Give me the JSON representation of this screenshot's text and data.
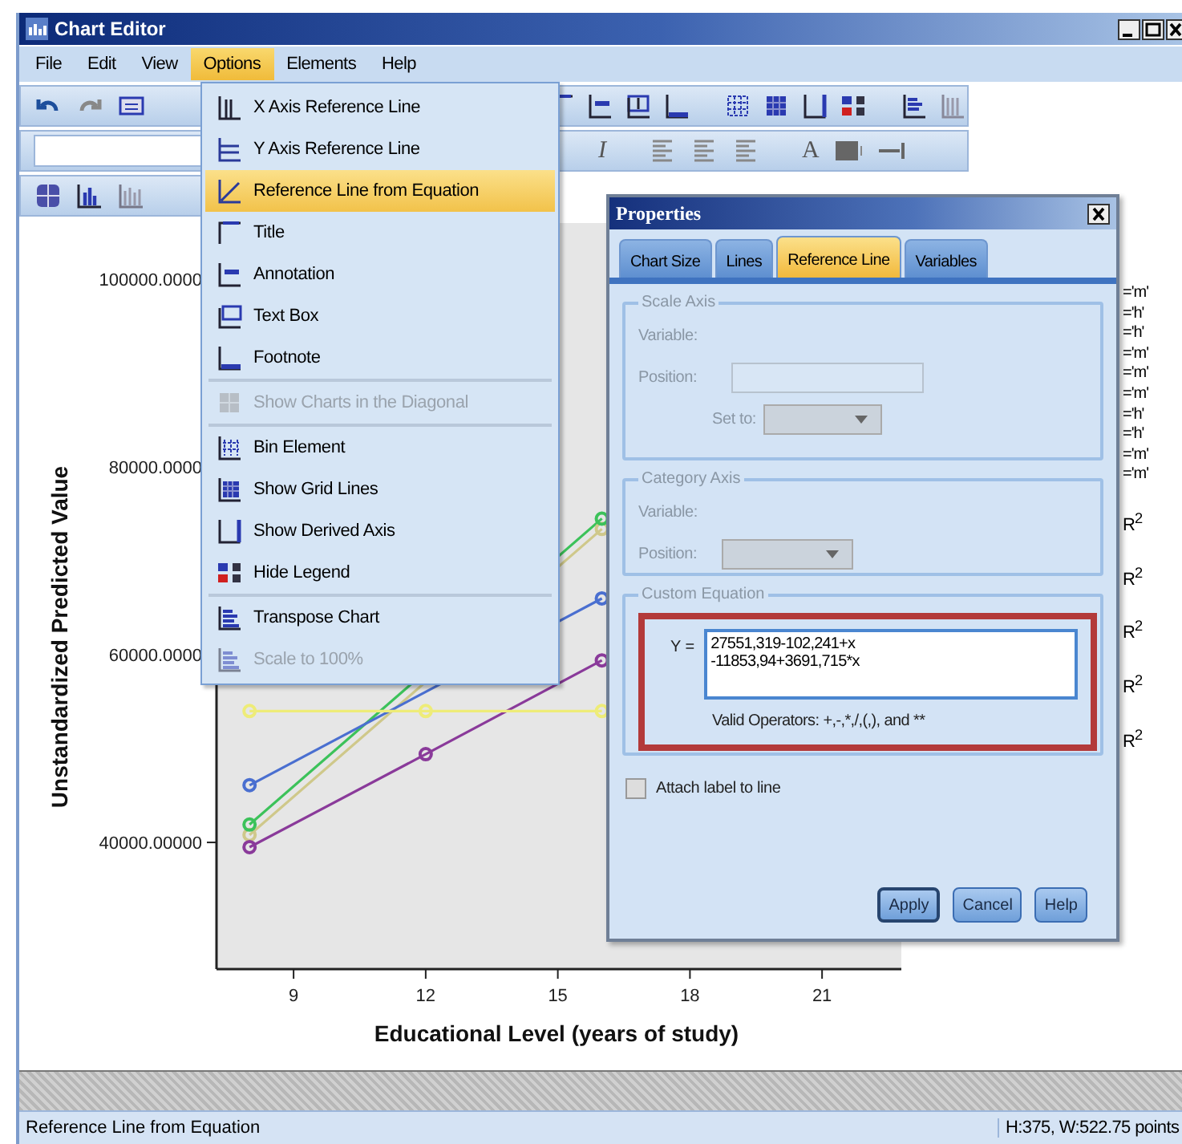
{
  "window": {
    "title": "Chart Editor"
  },
  "menubar": [
    {
      "label": "File",
      "selected": false
    },
    {
      "label": "Edit",
      "selected": false
    },
    {
      "label": "View",
      "selected": false
    },
    {
      "label": "Options",
      "selected": true
    },
    {
      "label": "Elements",
      "selected": false
    },
    {
      "label": "Help",
      "selected": false
    }
  ],
  "toolbar_format": {
    "italic": "I",
    "text_color": "A"
  },
  "options_menu": {
    "groups": [
      [
        {
          "label": "X Axis Reference Line",
          "disabled": false,
          "selected": false
        },
        {
          "label": "Y Axis Reference Line",
          "disabled": false,
          "selected": false
        },
        {
          "label": "Reference Line from Equation",
          "disabled": false,
          "selected": true
        },
        {
          "label": "Title",
          "disabled": false,
          "selected": false
        },
        {
          "label": "Annotation",
          "disabled": false,
          "selected": false
        },
        {
          "label": "Text Box",
          "disabled": false,
          "selected": false
        },
        {
          "label": "Footnote",
          "disabled": false,
          "selected": false
        }
      ],
      [
        {
          "label": "Show Charts in the Diagonal",
          "disabled": true,
          "selected": false
        }
      ],
      [
        {
          "label": "Bin Element",
          "disabled": false,
          "selected": false
        },
        {
          "label": "Show Grid Lines",
          "disabled": false,
          "selected": false
        },
        {
          "label": "Show Derived Axis",
          "disabled": false,
          "selected": false
        },
        {
          "label": "Hide Legend",
          "disabled": false,
          "selected": false
        }
      ],
      [
        {
          "label": "Transpose Chart",
          "disabled": false,
          "selected": false
        },
        {
          "label": "Scale to 100%",
          "disabled": true,
          "selected": false
        }
      ]
    ]
  },
  "chart": {
    "chart_data": {
      "type": "line",
      "xlabel": "Educational Level (years of study)",
      "ylabel": "Unstandardized Predicted Value",
      "x": [
        8,
        12,
        16
      ],
      "xlim": [
        7.25,
        22.8
      ],
      "ylim": [
        26500,
        106000
      ],
      "xticks": [
        9,
        12,
        15,
        18,
        21
      ],
      "yticks": [
        {
          "value": 100000,
          "label": "100000.0000"
        },
        {
          "value": 80000,
          "label": "80000.0000"
        },
        {
          "value": 60000,
          "label": "60000.0000"
        },
        {
          "value": 40000,
          "label": "40000.00000"
        }
      ],
      "series": [
        {
          "color": "#cfc88a",
          "marker": "circle",
          "values": [
            40800,
            null,
            73400
          ]
        },
        {
          "color": "#3cc25a",
          "marker": "circle",
          "values": [
            41900,
            null,
            74500
          ]
        },
        {
          "color": "#4a6fd0",
          "marker": "circle",
          "values": [
            46100,
            null,
            66000
          ]
        },
        {
          "color": "#8a3a9a",
          "marker": "circle",
          "values": [
            39500,
            49400,
            59400
          ]
        },
        {
          "color": "#eeec78",
          "marker": "circle",
          "values": [
            54000,
            54000,
            54000
          ]
        }
      ]
    },
    "legend": {
      "category_labels": [
        "='m'",
        "='h'",
        "='h'",
        "='m'",
        "='m'",
        "='m'",
        "='h'",
        "='h'",
        "='m'",
        "='m'"
      ],
      "fit_labels": [
        "R$^{2}$",
        "R$^{2}$",
        "R$^{2}$",
        "R$^{2}$",
        "R$^{2}$"
      ]
    }
  },
  "properties_dialog": {
    "title": "Properties",
    "tabs": [
      {
        "label": "Chart Size",
        "selected": false
      },
      {
        "label": "Lines",
        "selected": false
      },
      {
        "label": "Reference Line",
        "selected": true
      },
      {
        "label": "Variables",
        "selected": false
      }
    ],
    "scale_axis": {
      "legend": "Scale Axis",
      "variable_label": "Variable:",
      "position_label": "Position:",
      "set_to_label": "Set to:"
    },
    "category_axis": {
      "legend": "Category Axis",
      "variable_label": "Variable:",
      "position_label": "Position:"
    },
    "custom_equation": {
      "legend": "Custom Equation",
      "y_label": "Y =",
      "value": "27551,319-102,241+x\n-11853,94+3691,715*x",
      "hint": "Valid Operators: +,-,*,/,(,), and **"
    },
    "attach_label": {
      "label": "Attach label to line",
      "checked": false
    },
    "buttons": [
      "Apply",
      "Cancel",
      "Help"
    ]
  },
  "status_bar": {
    "message": "Reference Line from Equation",
    "size": "H:375, W:522.75 points"
  }
}
